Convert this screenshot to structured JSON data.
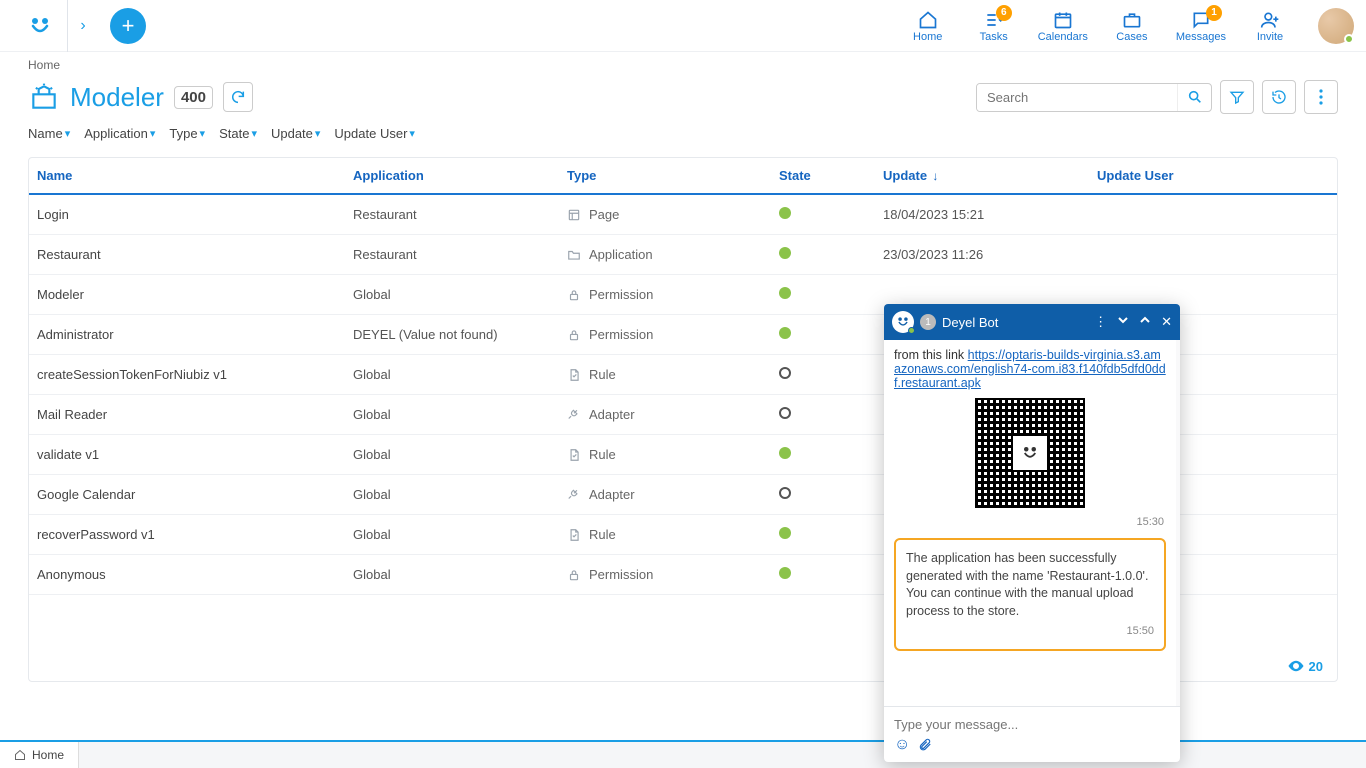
{
  "breadcrumb": "Home",
  "page": {
    "title": "Modeler",
    "count": "400"
  },
  "nav": {
    "home": "Home",
    "tasks": "Tasks",
    "tasks_badge": "6",
    "calendars": "Calendars",
    "cases": "Cases",
    "messages": "Messages",
    "messages_badge": "1",
    "invite": "Invite"
  },
  "search": {
    "placeholder": "Search"
  },
  "filters": [
    "Name",
    "Application",
    "Type",
    "State",
    "Update",
    "Update User"
  ],
  "columns": {
    "name": "Name",
    "application": "Application",
    "type": "Type",
    "state": "State",
    "update": "Update",
    "update_user": "Update User"
  },
  "rows": [
    {
      "name": "Login",
      "app": "Restaurant",
      "type": "Page",
      "type_icon": "page",
      "state": "green",
      "update": "18/04/2023 15:21",
      "user": true
    },
    {
      "name": "Restaurant",
      "app": "Restaurant",
      "type": "Application",
      "type_icon": "folder",
      "state": "green",
      "update": "23/03/2023 11:26",
      "user": true
    },
    {
      "name": "Modeler",
      "app": "Global",
      "type": "Permission",
      "type_icon": "lock",
      "state": "green",
      "update": "",
      "user": false
    },
    {
      "name": "Administrator",
      "app": "DEYEL (Value not found)",
      "type": "Permission",
      "type_icon": "lock",
      "state": "green",
      "update": "",
      "user": false
    },
    {
      "name": "createSessionTokenForNiubiz v1",
      "app": "Global",
      "type": "Rule",
      "type_icon": "rule",
      "state": "hollow",
      "update": "",
      "user": false
    },
    {
      "name": "Mail Reader",
      "app": "Global",
      "type": "Adapter",
      "type_icon": "adapter",
      "state": "hollow",
      "update": "",
      "user": false
    },
    {
      "name": "validate v1",
      "app": "Global",
      "type": "Rule",
      "type_icon": "rule",
      "state": "green",
      "update": "",
      "user": false
    },
    {
      "name": "Google Calendar",
      "app": "Global",
      "type": "Adapter",
      "type_icon": "adapter",
      "state": "hollow",
      "update": "",
      "user": false
    },
    {
      "name": "recoverPassword v1",
      "app": "Global",
      "type": "Rule",
      "type_icon": "rule",
      "state": "green",
      "update": "",
      "user": false
    },
    {
      "name": "Anonymous",
      "app": "Global",
      "type": "Permission",
      "type_icon": "lock",
      "state": "green",
      "update": "",
      "user": false
    }
  ],
  "footer_count": "20",
  "taskbar": {
    "home": "Home"
  },
  "chat": {
    "title": "Deyel Bot",
    "badge": "1",
    "prefix": "from this link ",
    "link": "https://optaris-builds-virginia.s3.amazonaws.com/english74-com.i83.f140fdb5dfd0ddf.restaurant.apk",
    "ts1": "15:30",
    "highlight": "The application has been successfully generated with the name 'Restaurant-1.0.0'. You can continue with the manual upload process to the store.",
    "ts2": "15:50",
    "placeholder": "Type your message..."
  }
}
